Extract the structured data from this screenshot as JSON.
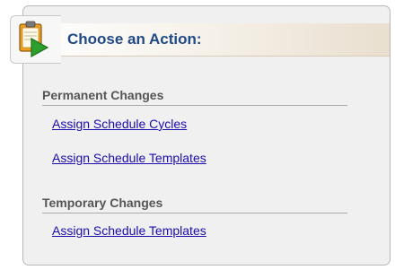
{
  "header": {
    "title": "Choose an Action:",
    "icon": "clipboard-arrow-icon"
  },
  "sections": [
    {
      "title": "Permanent Changes",
      "links": [
        "Assign Schedule Cycles",
        "Assign Schedule Templates"
      ]
    },
    {
      "title": "Temporary Changes",
      "links": [
        "Assign Schedule Templates"
      ]
    }
  ],
  "colors": {
    "header_text": "#1f4a87",
    "link": "#1a0dab",
    "section_text": "#555555",
    "panel_bg": "#f0f0f0",
    "icon_green": "#2e9f2e",
    "icon_orange": "#f0a020"
  }
}
